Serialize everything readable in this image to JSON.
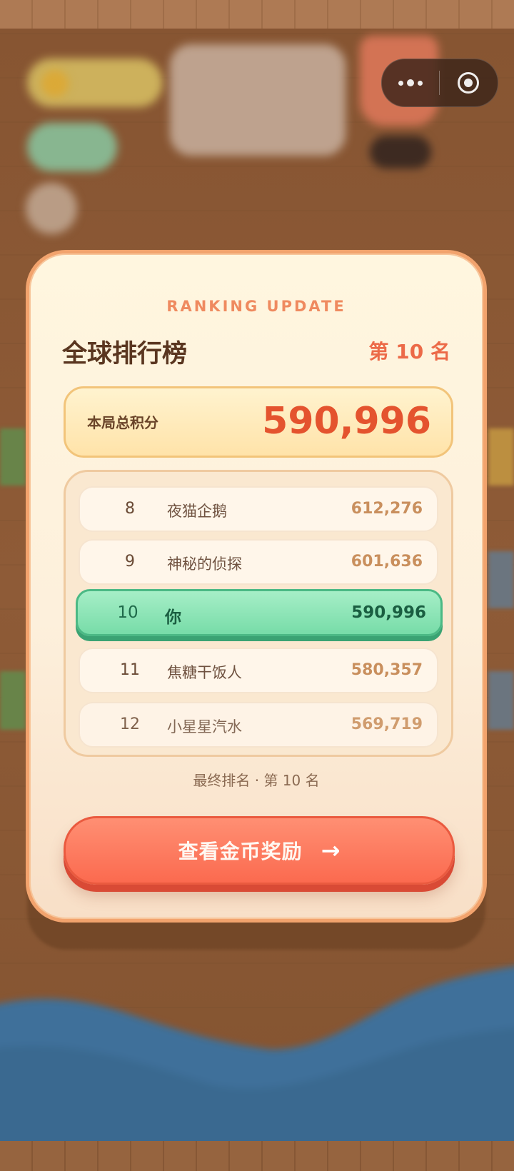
{
  "modal": {
    "eyebrow": "RANKING UPDATE",
    "title": "全球排行榜",
    "rank_text": "第 10 名",
    "score": {
      "label": "本局总积分",
      "value": "590,996"
    },
    "leaderboard": [
      {
        "rank": "8",
        "name": "夜猫企鹅",
        "score": "612,276",
        "is_player": false
      },
      {
        "rank": "9",
        "name": "神秘的侦探",
        "score": "601,636",
        "is_player": false
      },
      {
        "rank": "10",
        "name": "你",
        "score": "590,996",
        "is_player": true
      },
      {
        "rank": "11",
        "name": "焦糖干饭人",
        "score": "580,357",
        "is_player": false
      },
      {
        "rank": "12",
        "name": "小星星汽水",
        "score": "569,719",
        "is_player": false
      }
    ],
    "final_rank": "最终排名 · 第 10 名",
    "cta": {
      "label": "查看金币奖励",
      "arrow": "→"
    }
  },
  "capsule": {
    "more_icon": "more-dots-icon",
    "close_icon": "target-circle-icon"
  },
  "colors": {
    "accent": "#ec6a48",
    "player_row": "#77dca8",
    "cta": "#fb6a4f",
    "modal_border": "#f2a36d"
  }
}
